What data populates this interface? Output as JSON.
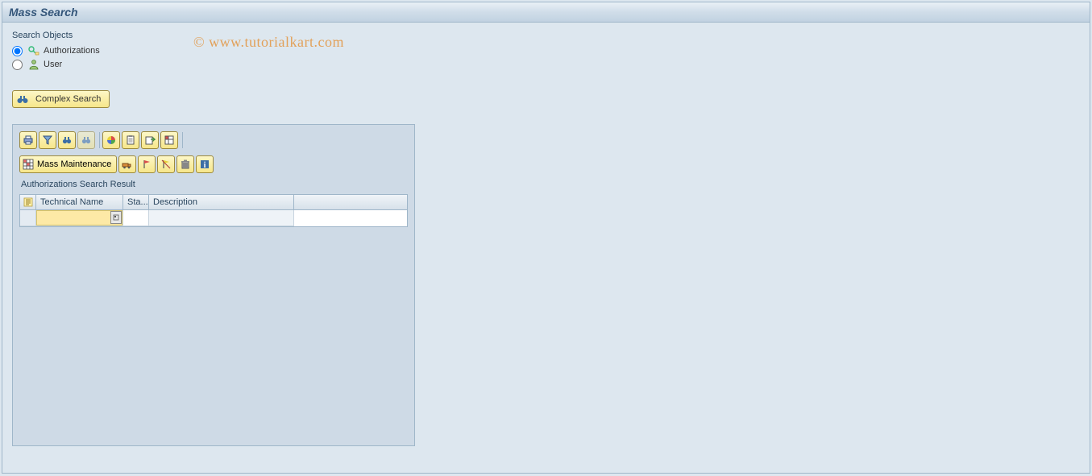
{
  "title": "Mass Search",
  "watermark": "© www.tutorialkart.com",
  "search_objects": {
    "label": "Search Objects",
    "authorizations": "Authorizations",
    "user": "User",
    "selected": "authorizations"
  },
  "complex_search": {
    "label": "Complex Search",
    "icon": "binoculars-icon"
  },
  "toolbar1": [
    {
      "name": "print-icon",
      "title": "Print"
    },
    {
      "name": "filter-icon",
      "title": "Filter"
    },
    {
      "name": "find-icon",
      "title": "Find"
    },
    {
      "name": "find-next-icon",
      "title": "Find Next",
      "disabled": true
    },
    {
      "sep": true
    },
    {
      "name": "chart-icon",
      "title": "Graphic"
    },
    {
      "name": "clipboard-icon",
      "title": "Copy"
    },
    {
      "name": "export-icon",
      "title": "Export"
    },
    {
      "name": "layout-icon",
      "title": "Change Layout"
    },
    {
      "sep": true
    }
  ],
  "mass_maintenance": {
    "label": "Mass Maintenance",
    "icon": "grid-icon"
  },
  "toolbar2": [
    {
      "name": "transport-icon",
      "title": "Transport"
    },
    {
      "name": "flag-red-icon",
      "title": "Set Flag"
    },
    {
      "name": "flag-yellow-icon",
      "title": "Reset Flag"
    },
    {
      "name": "delete-icon",
      "title": "Delete"
    },
    {
      "name": "info-icon",
      "title": "Information"
    }
  ],
  "result": {
    "label": "Authorizations Search Result",
    "columns": {
      "select_icon": "select-all-icon",
      "tech": "Technical Name",
      "sta": "Sta...",
      "desc": "Description"
    },
    "rows": [
      {
        "tech": "",
        "sta": "",
        "desc": ""
      }
    ]
  }
}
